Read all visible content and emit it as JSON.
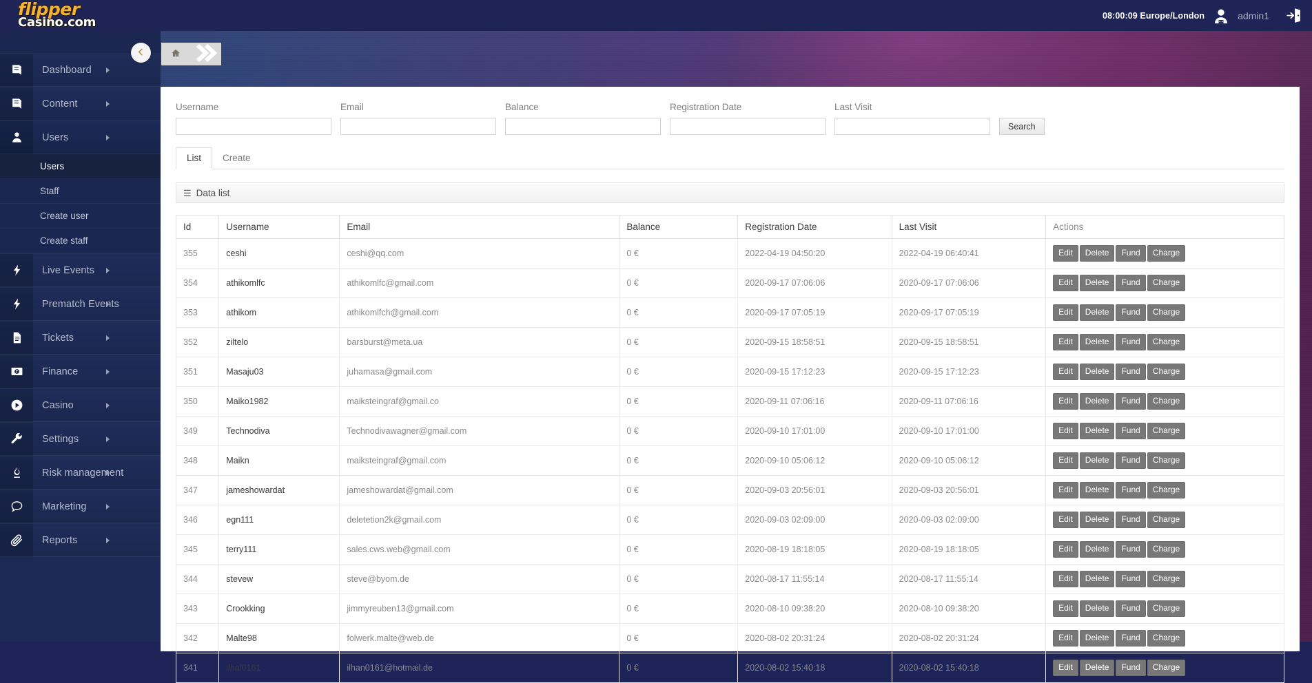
{
  "brand": {
    "line1": "flipper",
    "line2": "Casino.com"
  },
  "header": {
    "clock": "08:00:09 Europe/London",
    "username": "admin1",
    "user_icon": "user-avatar-icon",
    "logout_icon": "logout-icon"
  },
  "breadcrumb": {
    "home_icon": "home-icon",
    "chevron_icon": "chevron-right-icon"
  },
  "sidebar": {
    "collapse_icon": "chevron-left-icon",
    "items": [
      {
        "label": "Dashboard",
        "icon": "book-icon",
        "has_arrow": true,
        "active": false
      },
      {
        "label": "Content",
        "icon": "book-icon",
        "has_arrow": true,
        "active": false
      },
      {
        "label": "Users",
        "icon": "user-icon",
        "has_arrow": true,
        "active": true
      },
      {
        "label": "Live Events",
        "icon": "bolt-icon",
        "has_arrow": true,
        "active": false
      },
      {
        "label": "Prematch Events",
        "icon": "bolt-icon",
        "has_arrow": true,
        "active": false
      },
      {
        "label": "Tickets",
        "icon": "document-icon",
        "has_arrow": true,
        "active": false
      },
      {
        "label": "Finance",
        "icon": "money-icon",
        "has_arrow": true,
        "active": false
      },
      {
        "label": "Casino",
        "icon": "play-circle-icon",
        "has_arrow": true,
        "active": false
      },
      {
        "label": "Settings",
        "icon": "wrench-icon",
        "has_arrow": true,
        "active": false
      },
      {
        "label": "Risk management",
        "icon": "flame-icon",
        "has_arrow": true,
        "active": false
      },
      {
        "label": "Marketing",
        "icon": "chat-icon",
        "has_arrow": true,
        "active": false
      },
      {
        "label": "Reports",
        "icon": "paperclip-icon",
        "has_arrow": true,
        "active": false
      }
    ],
    "submenu": [
      {
        "label": "Users",
        "active": true
      },
      {
        "label": "Staff",
        "active": false
      },
      {
        "label": "Create user",
        "active": false
      },
      {
        "label": "Create staff",
        "active": false
      }
    ]
  },
  "filters": {
    "fields": [
      {
        "label": "Username",
        "value": "",
        "placeholder": ""
      },
      {
        "label": "Email",
        "value": "",
        "placeholder": ""
      },
      {
        "label": "Balance",
        "value": "",
        "placeholder": ""
      },
      {
        "label": "Registration Date",
        "value": "",
        "placeholder": ""
      },
      {
        "label": "Last Visit",
        "value": "",
        "placeholder": ""
      }
    ],
    "search_label": "Search"
  },
  "tabs": [
    {
      "label": "List",
      "active": true
    },
    {
      "label": "Create",
      "active": false
    }
  ],
  "datalist": {
    "title": "Data list",
    "icon": "hamburger-icon"
  },
  "table": {
    "columns": [
      "Id",
      "Username",
      "Email",
      "Balance",
      "Registration Date",
      "Last Visit",
      "Actions"
    ],
    "action_labels": [
      "Edit",
      "Delete",
      "Fund",
      "Charge"
    ],
    "rows": [
      {
        "id": "355",
        "username": "ceshi",
        "email": "ceshi@qq.com",
        "balance": "0 €",
        "registration": "2022-04-19 04:50:20",
        "last_visit": "2022-04-19 06:40:41"
      },
      {
        "id": "354",
        "username": "athikomlfc",
        "email": "athikomlfc@gmail.com",
        "balance": "0 €",
        "registration": "2020-09-17 07:06:06",
        "last_visit": "2020-09-17 07:06:06"
      },
      {
        "id": "353",
        "username": "athikom",
        "email": "athikomlfch@gmail.com",
        "balance": "0 €",
        "registration": "2020-09-17 07:05:19",
        "last_visit": "2020-09-17 07:05:19"
      },
      {
        "id": "352",
        "username": "ziltelo",
        "email": "barsburst@meta.ua",
        "balance": "0 €",
        "registration": "2020-09-15 18:58:51",
        "last_visit": "2020-09-15 18:58:51"
      },
      {
        "id": "351",
        "username": "Masaju03",
        "email": "juhamasa@gmail.com",
        "balance": "0 €",
        "registration": "2020-09-15 17:12:23",
        "last_visit": "2020-09-15 17:12:23"
      },
      {
        "id": "350",
        "username": "Maiko1982",
        "email": "maiksteingraf@gmail.co",
        "balance": "0 €",
        "registration": "2020-09-11 07:06:16",
        "last_visit": "2020-09-11 07:06:16"
      },
      {
        "id": "349",
        "username": "Technodiva",
        "email": "Technodivawagner@gmail.com",
        "balance": "0 €",
        "registration": "2020-09-10 17:01:00",
        "last_visit": "2020-09-10 17:01:00"
      },
      {
        "id": "348",
        "username": "Maikn",
        "email": "maiksteingraf@gmail.com",
        "balance": "0 €",
        "registration": "2020-09-10 05:06:12",
        "last_visit": "2020-09-10 05:06:12"
      },
      {
        "id": "347",
        "username": "jameshowardat",
        "email": "jameshowardat@gmail.com",
        "balance": "0 €",
        "registration": "2020-09-03 20:56:01",
        "last_visit": "2020-09-03 20:56:01"
      },
      {
        "id": "346",
        "username": "egn111",
        "email": "deletetion2k@gmail.com",
        "balance": "0 €",
        "registration": "2020-09-03 02:09:00",
        "last_visit": "2020-09-03 02:09:00"
      },
      {
        "id": "345",
        "username": "terry111",
        "email": "sales.cws.web@gmail.com",
        "balance": "0 €",
        "registration": "2020-08-19 18:18:05",
        "last_visit": "2020-08-19 18:18:05"
      },
      {
        "id": "344",
        "username": "stevew",
        "email": "steve@byom.de",
        "balance": "0 €",
        "registration": "2020-08-17 11:55:14",
        "last_visit": "2020-08-17 11:55:14"
      },
      {
        "id": "343",
        "username": "Crookking",
        "email": "jimmyreuben13@gmail.com",
        "balance": "0 €",
        "registration": "2020-08-10 09:38:20",
        "last_visit": "2020-08-10 09:38:20"
      },
      {
        "id": "342",
        "username": "Malte98",
        "email": "folwerk.malte@web.de",
        "balance": "0 €",
        "registration": "2020-08-02 20:31:24",
        "last_visit": "2020-08-02 20:31:24"
      },
      {
        "id": "341",
        "username": "ilhal0161",
        "email": "ilhan0161@hotmail.de",
        "balance": "0 €",
        "registration": "2020-08-02 15:40:18",
        "last_visit": "2020-08-02 15:40:18"
      }
    ]
  },
  "colors": {
    "topbar": "#1e2456",
    "sidebar": "#1d2a55",
    "brand_yellow": "#f5b335",
    "action_button": "#787878",
    "panel": "#ffffff"
  }
}
